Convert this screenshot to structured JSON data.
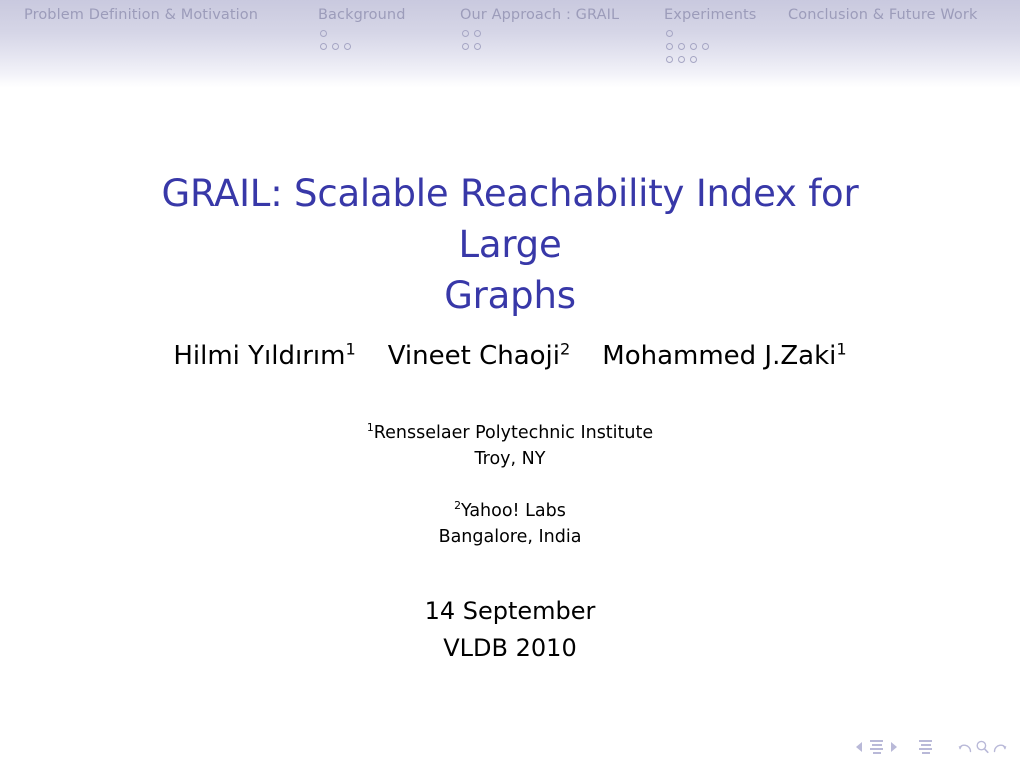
{
  "presentation": {
    "title": "GRAIL: Scalable Reachability Index for Large Graphs",
    "title_line1": "GRAIL: Scalable Reachability Index for Large",
    "title_line2": "Graphs",
    "title_color": "#3838a8"
  },
  "navbar": {
    "background_top_color": "#c9c9df",
    "background_bottom_color": "#ffffff",
    "text_color": "#9c9cba",
    "dot_color": "#a6a6c4",
    "sections": [
      {
        "label": "Problem Definition & Motivation",
        "subsection_dot_rows": []
      },
      {
        "label": "Background",
        "subsection_dot_rows": [
          1,
          3
        ]
      },
      {
        "label": "Our Approach : GRAIL",
        "subsection_dot_rows": [
          2,
          2
        ]
      },
      {
        "label": "Experiments",
        "subsection_dot_rows": [
          1,
          4,
          3
        ]
      },
      {
        "label": "Conclusion & Future Work",
        "subsection_dot_rows": []
      }
    ]
  },
  "authors": [
    {
      "name": "Hilmi Yıldırım",
      "affiliation_marker": "1"
    },
    {
      "name": "Vineet Chaoji",
      "affiliation_marker": "2"
    },
    {
      "name": "Mohammed J.Zaki",
      "affiliation_marker": "1"
    }
  ],
  "affiliations": [
    {
      "marker": "1",
      "institution": "Rensselaer Polytechnic Institute",
      "location": "Troy, NY"
    },
    {
      "marker": "2",
      "institution": "Yahoo! Labs",
      "location": "Bangalore, India"
    }
  ],
  "date": {
    "day": "14 September",
    "venue": "VLDB 2010"
  },
  "nav_symbols": {
    "color": "#b9b9d8",
    "items": [
      "previous-slide-icon",
      "slide-icon",
      "next-slide-icon",
      "frame-icon",
      "back-icon",
      "search-icon",
      "forward-icon"
    ]
  }
}
